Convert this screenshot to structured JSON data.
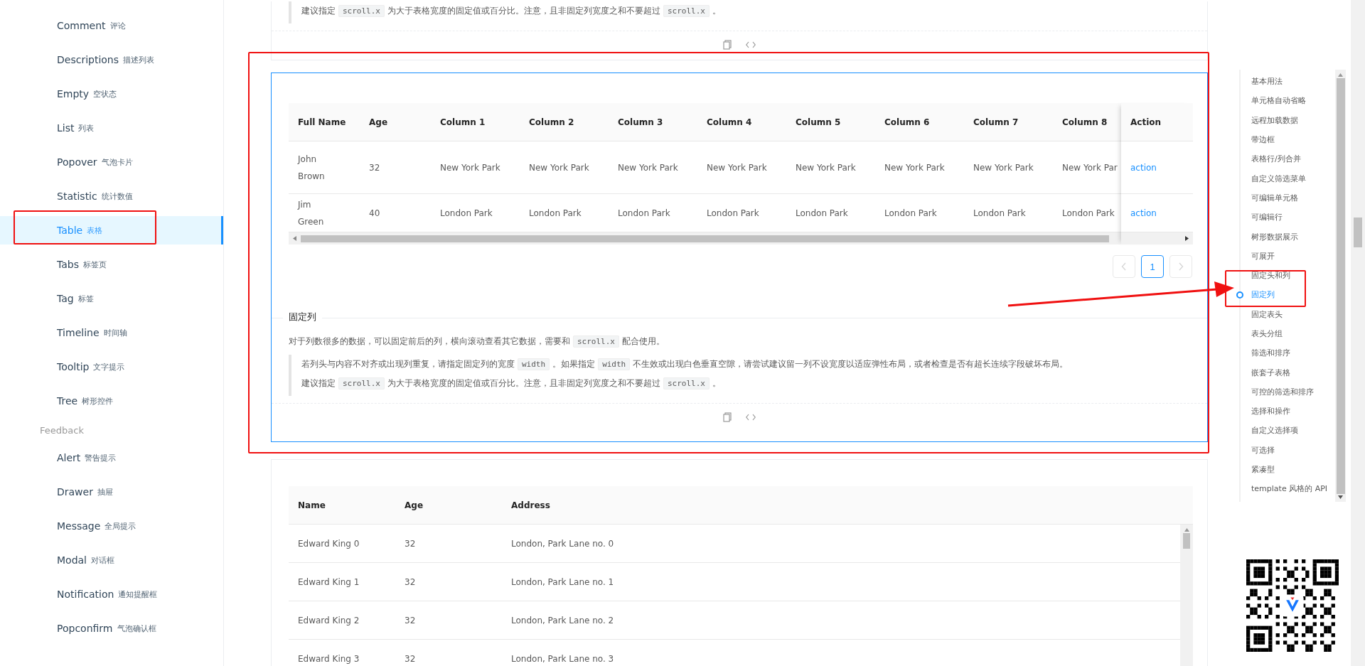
{
  "sidebar": {
    "entries": [
      {
        "kind": "item",
        "label": "Comment",
        "sublabel": "评论",
        "selected": false
      },
      {
        "kind": "item",
        "label": "Descriptions",
        "sublabel": "描述列表",
        "selected": false
      },
      {
        "kind": "item",
        "label": "Empty",
        "sublabel": "空状态",
        "selected": false
      },
      {
        "kind": "item",
        "label": "List",
        "sublabel": "列表",
        "selected": false
      },
      {
        "kind": "item",
        "label": "Popover",
        "sublabel": "气泡卡片",
        "selected": false
      },
      {
        "kind": "item",
        "label": "Statistic",
        "sublabel": "统计数值",
        "selected": false
      },
      {
        "kind": "item",
        "label": "Table",
        "sublabel": "表格",
        "selected": true
      },
      {
        "kind": "item",
        "label": "Tabs",
        "sublabel": "标签页",
        "selected": false
      },
      {
        "kind": "item",
        "label": "Tag",
        "sublabel": "标签",
        "selected": false
      },
      {
        "kind": "item",
        "label": "Timeline",
        "sublabel": "时间轴",
        "selected": false
      },
      {
        "kind": "item",
        "label": "Tooltip",
        "sublabel": "文字提示",
        "selected": false
      },
      {
        "kind": "item",
        "label": "Tree",
        "sublabel": "树形控件",
        "selected": false
      },
      {
        "kind": "group",
        "label": "Feedback"
      },
      {
        "kind": "item",
        "label": "Alert",
        "sublabel": "警告提示",
        "selected": false
      },
      {
        "kind": "item",
        "label": "Drawer",
        "sublabel": "抽屉",
        "selected": false
      },
      {
        "kind": "item",
        "label": "Message",
        "sublabel": "全局提示",
        "selected": false
      },
      {
        "kind": "item",
        "label": "Modal",
        "sublabel": "对话框",
        "selected": false
      },
      {
        "kind": "item",
        "label": "Notification",
        "sublabel": "通知提醒框",
        "selected": false
      },
      {
        "kind": "item",
        "label": "Popconfirm",
        "sublabel": "气泡确认框",
        "selected": false
      }
    ]
  },
  "previous_demo": {
    "note": [
      {
        "kind": "text",
        "text": "建议指定"
      },
      {
        "kind": "code",
        "text": "scroll.x"
      },
      {
        "kind": "text",
        "text": "为大于表格宽度的固定值或百分比。注意，且非固定列宽度之和不要超过"
      },
      {
        "kind": "code",
        "text": "scroll.x"
      },
      {
        "kind": "text",
        "text": "。"
      }
    ]
  },
  "fixed_columns_demo": {
    "table": {
      "columns": [
        "Full Name",
        "Age",
        "Column 1",
        "Column 2",
        "Column 3",
        "Column 4",
        "Column 5",
        "Column 6",
        "Column 7",
        "Column 8"
      ],
      "action_column": "Action",
      "rows": [
        {
          "cells": [
            "John Brown",
            "32",
            "New York Park",
            "New York Park",
            "New York Park",
            "New York Park",
            "New York Park",
            "New York Park",
            "New York Park",
            "New York Par"
          ],
          "action": "action"
        },
        {
          "cells": [
            "Jim Green",
            "40",
            "London Park",
            "London Park",
            "London Park",
            "London Park",
            "London Park",
            "London Park",
            "London Park",
            "London Park"
          ],
          "action": "action"
        }
      ]
    },
    "pagination": {
      "pages": [
        {
          "label": "1",
          "selected": true
        }
      ]
    },
    "title": "固定列",
    "description": [
      {
        "kind": "text",
        "text": "对于列数很多的数据，可以固定前后的列，横向滚动查看其它数据，需要和"
      },
      {
        "kind": "code",
        "text": "scroll.x"
      },
      {
        "kind": "text",
        "text": "配合使用。"
      }
    ],
    "notes": [
      [
        {
          "kind": "text",
          "text": "若列头与内容不对齐或出现列重复，请指定固定列的宽度"
        },
        {
          "kind": "code",
          "text": "width"
        },
        {
          "kind": "text",
          "text": "。如果指定"
        },
        {
          "kind": "code",
          "text": "width"
        },
        {
          "kind": "text",
          "text": "不生效或出现白色垂直空隙，请尝试建议留一列不设宽度以适应弹性布局，或者检查是否有超长连续字段破坏布局。"
        }
      ],
      [
        {
          "kind": "text",
          "text": "建议指定"
        },
        {
          "kind": "code",
          "text": "scroll.x"
        },
        {
          "kind": "text",
          "text": "为大于表格宽度的固定值或百分比。注意，且非固定列宽度之和不要超过"
        },
        {
          "kind": "code",
          "text": "scroll.x"
        },
        {
          "kind": "text",
          "text": "。"
        }
      ]
    ]
  },
  "next_demo": {
    "table": {
      "columns": [
        "Name",
        "Age",
        "Address"
      ],
      "rows": [
        [
          "Edward King 0",
          "32",
          "London, Park Lane no. 0"
        ],
        [
          "Edward King 1",
          "32",
          "London, Park Lane no. 1"
        ],
        [
          "Edward King 2",
          "32",
          "London, Park Lane no. 2"
        ],
        [
          "Edward King 3",
          "32",
          "London, Park Lane no. 3"
        ]
      ]
    }
  },
  "anchor": {
    "items": [
      {
        "label": "基本用法",
        "selected": false
      },
      {
        "label": "单元格自动省略",
        "selected": false
      },
      {
        "label": "远程加载数据",
        "selected": false
      },
      {
        "label": "带边框",
        "selected": false
      },
      {
        "label": "表格行/列合并",
        "selected": false
      },
      {
        "label": "自定义筛选菜单",
        "selected": false
      },
      {
        "label": "可编辑单元格",
        "selected": false
      },
      {
        "label": "可编辑行",
        "selected": false
      },
      {
        "label": "树形数据展示",
        "selected": false
      },
      {
        "label": "可展开",
        "selected": false
      },
      {
        "label": "固定头和列",
        "selected": false
      },
      {
        "label": "固定列",
        "selected": true
      },
      {
        "label": "固定表头",
        "selected": false
      },
      {
        "label": "表头分组",
        "selected": false
      },
      {
        "label": "筛选和排序",
        "selected": false
      },
      {
        "label": "嵌套子表格",
        "selected": false
      },
      {
        "label": "可控的筛选和排序",
        "selected": false
      },
      {
        "label": "选择和操作",
        "selected": false
      },
      {
        "label": "自定义选择项",
        "selected": false
      },
      {
        "label": "可选择",
        "selected": false
      },
      {
        "label": "紧凑型",
        "selected": false
      },
      {
        "label": "template 风格的 API",
        "selected": false
      }
    ]
  }
}
